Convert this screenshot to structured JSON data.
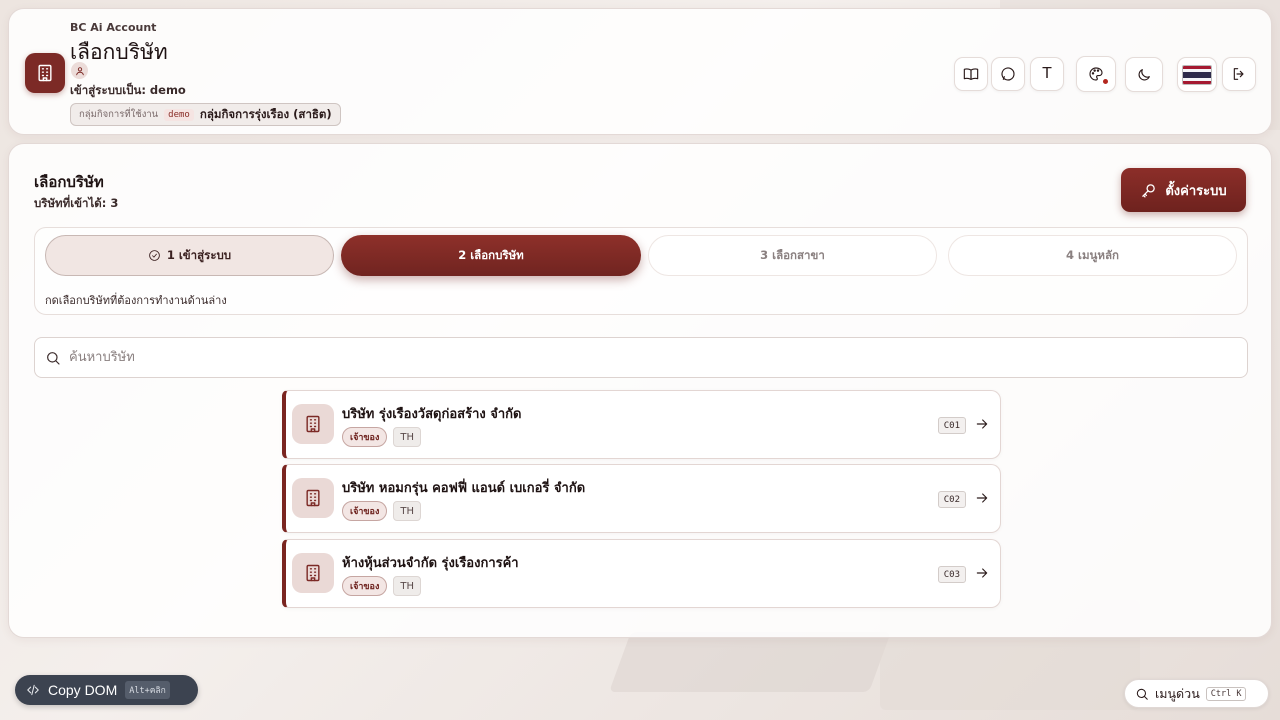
{
  "header": {
    "app_name": "BC Ai Account",
    "title": "เลือกบริษัท",
    "logged_in_as": "เข้าสู่ระบบเป็น: demo",
    "group_label": "กลุ่มกิจการที่ใช้งาน",
    "group_code": "demo",
    "group_name": "กลุ่มกิจการรุ่งเรือง (สาธิต)",
    "icons": [
      "building-icon",
      "user-icon",
      "book-icon",
      "chat-icon",
      "text-size-icon",
      "palette-icon",
      "moon-icon",
      "thai-flag-icon",
      "logout-icon"
    ],
    "font_button_label": "T"
  },
  "main": {
    "title": "เลือกบริษัท",
    "subtitle": "บริษัทที่เข้าได้: 3",
    "settings_label": "ตั้งค่าระบบ",
    "steps": [
      {
        "label": "1 เข้าสู่ระบบ",
        "state": "done"
      },
      {
        "label": "2 เลือกบริษัท",
        "state": "active"
      },
      {
        "label": "3 เลือกสาขา",
        "state": "todo"
      },
      {
        "label": "4 เมนูหลัก",
        "state": "todo"
      }
    ],
    "hint": "กดเลือกบริษัทที่ต้องการทำงานด้านล่าง",
    "search_placeholder": "ค้นหาบริษัท",
    "companies": [
      {
        "name": "บริษัท รุ่งเรืองวัสดุก่อสร้าง จำกัด",
        "role": "เจ้าของ",
        "lang": "TH",
        "code": "C01"
      },
      {
        "name": "บริษัท หอมกรุ่น คอฟฟี่ แอนด์ เบเกอรี่ จำกัด",
        "role": "เจ้าของ",
        "lang": "TH",
        "code": "C02"
      },
      {
        "name": "ห้างหุ้นส่วนจำกัด รุ่งเรืองการค้า",
        "role": "เจ้าของ",
        "lang": "TH",
        "code": "C03"
      }
    ]
  },
  "footer": {
    "copy_dom_label": "Copy DOM",
    "copy_dom_shortcut": "Alt+คลิก",
    "quick_menu_label": "เมนูด่วน",
    "quick_menu_shortcut": "Ctrl K"
  },
  "colors": {
    "brand": "#7c2a26",
    "brand_dark": "#6e221e",
    "background": "#ede5e0"
  }
}
